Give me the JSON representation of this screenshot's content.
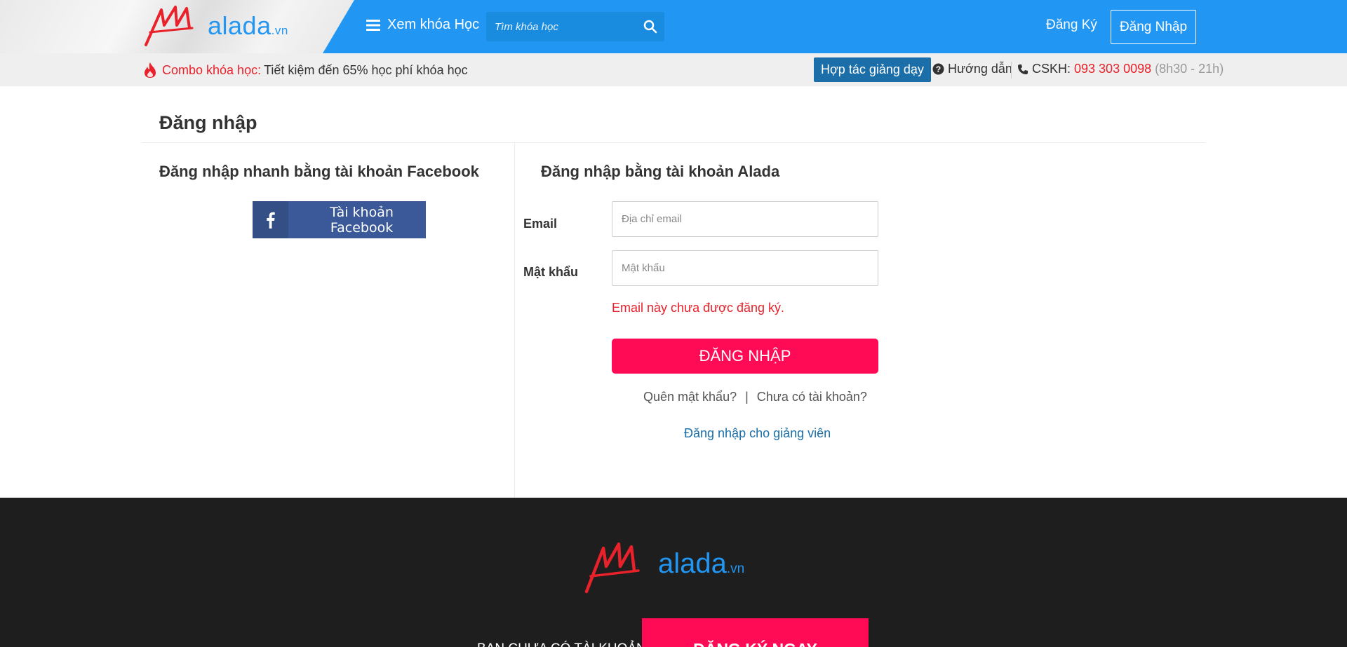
{
  "header": {
    "logo_text": "alada",
    "logo_suffix": ".vn",
    "browse_label": "Xem khóa Học",
    "search_placeholder": "Tìm khóa học",
    "signup_label": "Đăng Ký",
    "login_label": "Đăng Nhập",
    "primary_color": "#2196f3"
  },
  "subbar": {
    "combo_label": "Combo khóa học:",
    "combo_text": "Tiết kiệm đến 65% học phí khóa học",
    "partner_label": "Hợp tác giảng dạy",
    "guide_label": "Hướng dẫn",
    "cskh_label": "CSKH:",
    "cskh_phone": "093 303 0098",
    "cskh_hours": "(8h30 - 21h)"
  },
  "main": {
    "page_title": "Đăng nhập",
    "facebook": {
      "heading": "Đăng nhập nhanh bằng tài khoản Facebook",
      "button_label": "Tài khoản Facebook",
      "color": "#3b5998"
    },
    "alada_form": {
      "heading": "Đăng nhập bằng tài khoản Alada",
      "email_label": "Email",
      "email_placeholder": "Địa chỉ email",
      "email_value": "",
      "password_label": "Mật khẩu",
      "password_placeholder": "Mật khẩu",
      "password_value": "",
      "error_message": "Email này chưa được đăng ký.",
      "submit_label": "ĐĂNG NHẬP",
      "forgot_label": "Quên mật khẩu?",
      "separator": "|",
      "no_account_label": "Chưa có tài khoản?",
      "instructor_label": "Đăng nhập cho giảng viên",
      "accent_color": "#ff0a54",
      "error_color": "#e8212a"
    }
  },
  "footer": {
    "logo_text": "alada",
    "logo_suffix": ".vn",
    "no_account_text": "BẠN CHƯA CÓ TÀI KHOẢN?",
    "register_label": "ĐĂNG KÝ NGAY"
  }
}
